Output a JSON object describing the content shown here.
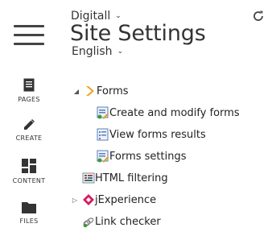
{
  "header": {
    "site": "Digitall",
    "title": "Site Settings",
    "language": "English"
  },
  "nav": {
    "items": [
      {
        "label": "PAGES",
        "icon": "pages-icon"
      },
      {
        "label": "CREATE",
        "icon": "pencil-icon"
      },
      {
        "label": "CONTENT",
        "icon": "content-grid-icon"
      },
      {
        "label": "FILES",
        "icon": "folder-icon"
      }
    ]
  },
  "tree": {
    "items": [
      {
        "label": "Forms",
        "icon": "forms-chevron-icon",
        "expanded": true
      },
      {
        "label": "Create and modify forms",
        "icon": "form-edit-icon"
      },
      {
        "label": "View forms results",
        "icon": "form-results-icon"
      },
      {
        "label": "Forms settings",
        "icon": "form-settings-icon"
      },
      {
        "label": "HTML filtering",
        "icon": "html-filter-icon"
      },
      {
        "label": "jExperience",
        "icon": "jexperience-icon",
        "expanded": false
      },
      {
        "label": "Link checker",
        "icon": "link-checker-icon"
      }
    ]
  },
  "colors": {
    "text": "#222222",
    "icon": "#444444",
    "accent_orange": "#f0a020",
    "accent_pink": "#d81b60"
  }
}
